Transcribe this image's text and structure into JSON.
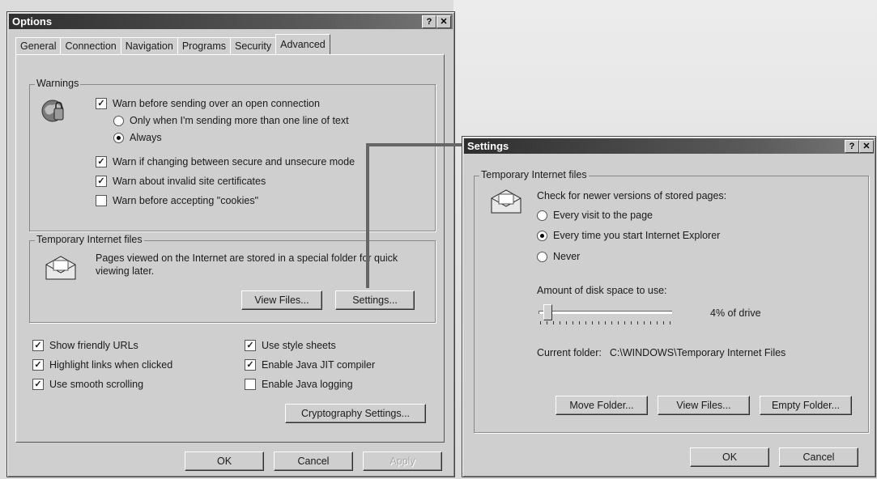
{
  "options": {
    "title": "Options",
    "help_glyph": "?",
    "close_glyph": "✕",
    "tabs": [
      "General",
      "Connection",
      "Navigation",
      "Programs",
      "Security",
      "Advanced"
    ],
    "warnings": {
      "label": "Warnings",
      "warn_open_connection": "Warn before sending over an open connection",
      "only_one_line": "Only when I'm sending more than one line of text",
      "always": "Always",
      "warn_secure_change": "Warn if changing between secure and unsecure mode",
      "warn_invalid_certs": "Warn about invalid site certificates",
      "warn_cookies": "Warn before accepting \"cookies\""
    },
    "temp_files": {
      "label": "Temporary Internet files",
      "description": "Pages viewed on the Internet are stored in a special folder for quick viewing later.",
      "view_files": "View Files...",
      "settings": "Settings..."
    },
    "checks": {
      "friendly_urls": "Show friendly URLs",
      "highlight_links": "Highlight links when clicked",
      "smooth_scrolling": "Use smooth scrolling",
      "style_sheets": "Use style sheets",
      "java_jit": "Enable Java JIT compiler",
      "java_logging": "Enable Java logging"
    },
    "crypto_settings": "Cryptography Settings...",
    "ok": "OK",
    "cancel": "Cancel",
    "apply": "Apply"
  },
  "settings": {
    "title": "Settings",
    "help_glyph": "?",
    "close_glyph": "✕",
    "group_label": "Temporary Internet files",
    "check_newer": "Check for newer versions of stored pages:",
    "every_visit": "Every visit to the page",
    "every_time": "Every time you start Internet Explorer",
    "never": "Never",
    "disk_space_label": "Amount of disk space to use:",
    "disk_space_value": "4% of drive",
    "disk_space_level": 0.04,
    "current_folder_label": "Current folder:",
    "current_folder_path": "C:\\WINDOWS\\Temporary Internet Files",
    "move_folder": "Move Folder...",
    "view_files": "View Files...",
    "empty_folder": "Empty Folder...",
    "ok": "OK",
    "cancel": "Cancel"
  }
}
